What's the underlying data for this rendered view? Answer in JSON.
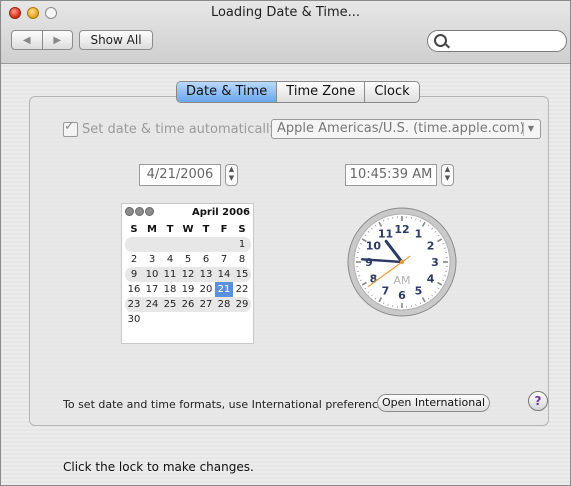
{
  "window": {
    "title": "Loading Date & Time..."
  },
  "toolbar": {
    "back_icon": "back-arrow-icon",
    "forward_icon": "forward-arrow-icon",
    "show_all_label": "Show All",
    "search_value": "",
    "search_icon": "search-icon"
  },
  "tabs": [
    {
      "label": "Date & Time",
      "active": true
    },
    {
      "label": "Time Zone",
      "active": false
    },
    {
      "label": "Clock",
      "active": false
    }
  ],
  "auto_setting": {
    "checkbox_label": "Set date & time automatically:",
    "checked": true,
    "server": "Apple Americas/U.S. (time.apple.com)"
  },
  "date_field": "4/21/2006",
  "time_field": "10:45:39 AM",
  "calendar": {
    "month_label": "April 2006",
    "weekdays": [
      "S",
      "M",
      "T",
      "W",
      "T",
      "F",
      "S"
    ],
    "weeks": [
      [
        "",
        "",
        "",
        "",
        "",
        "",
        "1"
      ],
      [
        "2",
        "3",
        "4",
        "5",
        "6",
        "7",
        "8"
      ],
      [
        "9",
        "10",
        "11",
        "12",
        "13",
        "14",
        "15"
      ],
      [
        "16",
        "17",
        "18",
        "19",
        "20",
        "21",
        "22"
      ],
      [
        "23",
        "24",
        "25",
        "26",
        "27",
        "28",
        "29"
      ],
      [
        "30",
        "",
        "",
        "",
        "",
        "",
        ""
      ]
    ],
    "selected_day": "21"
  },
  "clock": {
    "numbers": [
      "12",
      "1",
      "2",
      "3",
      "4",
      "5",
      "6",
      "7",
      "8",
      "9",
      "10",
      "11"
    ],
    "ampm": "AM",
    "hour": 10,
    "minute": 45,
    "second": 39
  },
  "footer": {
    "intl_text": "To set date and time formats, use International preferences.",
    "intl_button": "Open International",
    "help_label": "?",
    "lock_text": "Click the lock to make changes."
  },
  "colors": {
    "tab_active": "#6aa6ec",
    "selected_day": "#5b91dc",
    "second_hand": "#e89a3a",
    "hands": "#2b3a66"
  }
}
